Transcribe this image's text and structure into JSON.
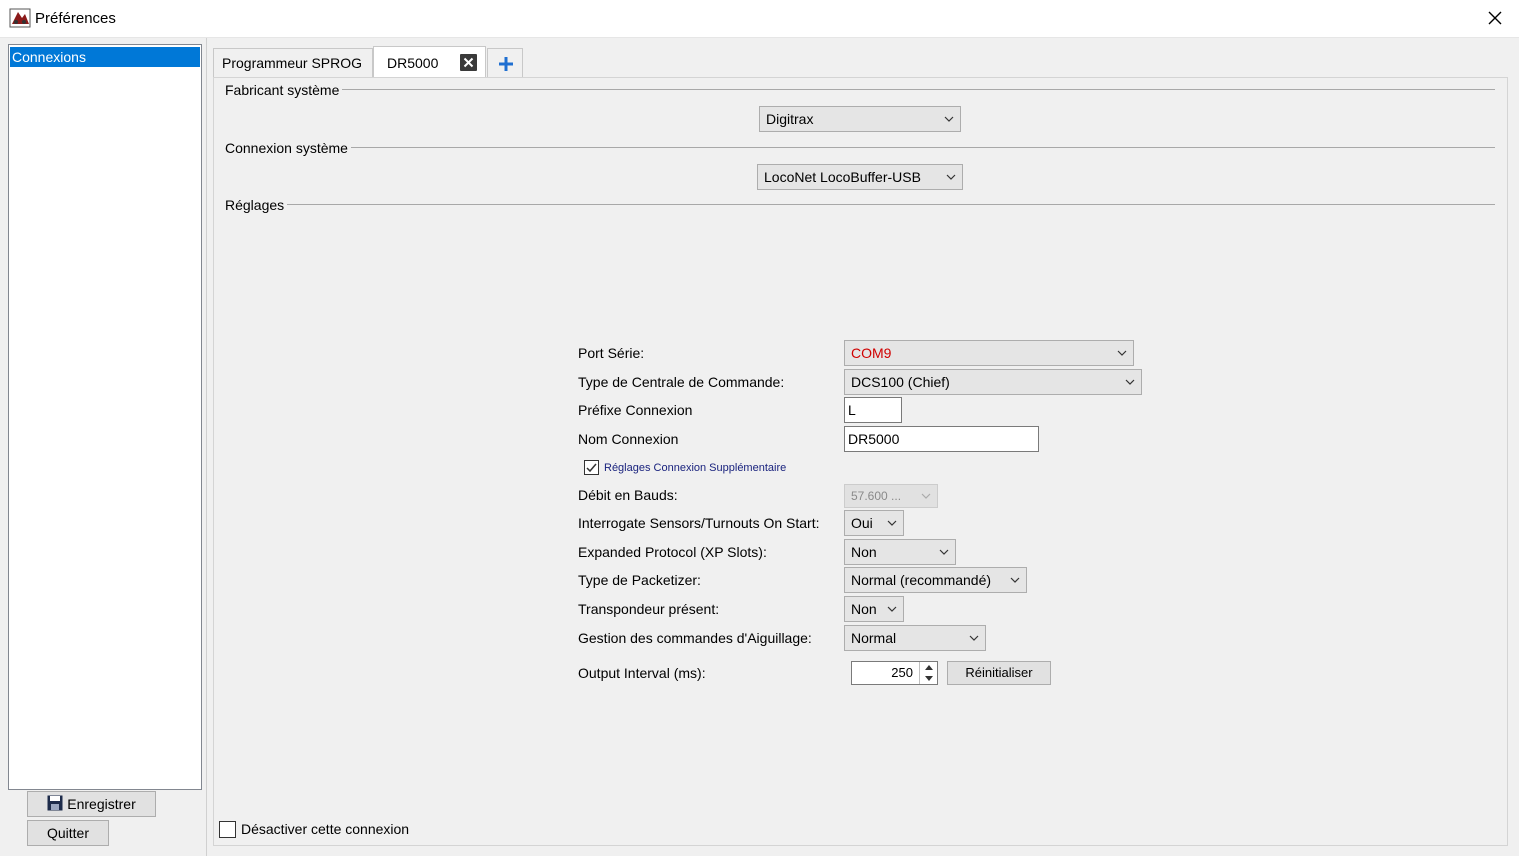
{
  "window": {
    "title": "Préférences"
  },
  "sidebar": {
    "items": [
      {
        "label": "Connexions"
      }
    ]
  },
  "buttons": {
    "save_label": "Enregistrer",
    "quit_label": "Quitter"
  },
  "tabs": [
    {
      "label": "Programmeur SPROG"
    },
    {
      "label": "DR5000"
    }
  ],
  "sections": {
    "manufacturer": {
      "title": "Fabricant  système",
      "value": "Digitrax"
    },
    "connection": {
      "title": "Connexion système",
      "value": "LocoNet LocoBuffer-USB"
    },
    "settings": {
      "title": "Réglages"
    }
  },
  "settings": {
    "serial_port": {
      "label": "Port Série:",
      "value": "COM9"
    },
    "command_station": {
      "label": "Type de Centrale de Commande:",
      "value": "DCS100 (Chief)"
    },
    "prefix": {
      "label": "Préfixe Connexion",
      "value": "L"
    },
    "name": {
      "label": "Nom Connexion",
      "value": "DR5000"
    },
    "additional": {
      "label": "Réglages Connexion Supplémentaire",
      "checked": true
    },
    "baud": {
      "label": "Débit en Bauds:",
      "value": "57.600 ..."
    },
    "interrogate": {
      "label": "Interrogate Sensors/Turnouts On Start:",
      "value": "Oui"
    },
    "expanded": {
      "label": "Expanded Protocol (XP Slots):",
      "value": "Non"
    },
    "packetizer": {
      "label": "Type de Packetizer:",
      "value": "Normal (recommandé)"
    },
    "transponder": {
      "label": "Transpondeur présent:",
      "value": "Non"
    },
    "turnout": {
      "label": "Gestion des commandes d'Aiguillage:",
      "value": "Normal"
    },
    "output_interval": {
      "label": "Output Interval (ms):",
      "value": "250",
      "reset_label": "Réinitialiser"
    }
  },
  "footer": {
    "disable_label": "Désactiver cette connexion",
    "checked": false
  },
  "colors": {
    "selection": "#0078d7",
    "port_text": "#d00000",
    "link_blue": "#1a237e"
  }
}
